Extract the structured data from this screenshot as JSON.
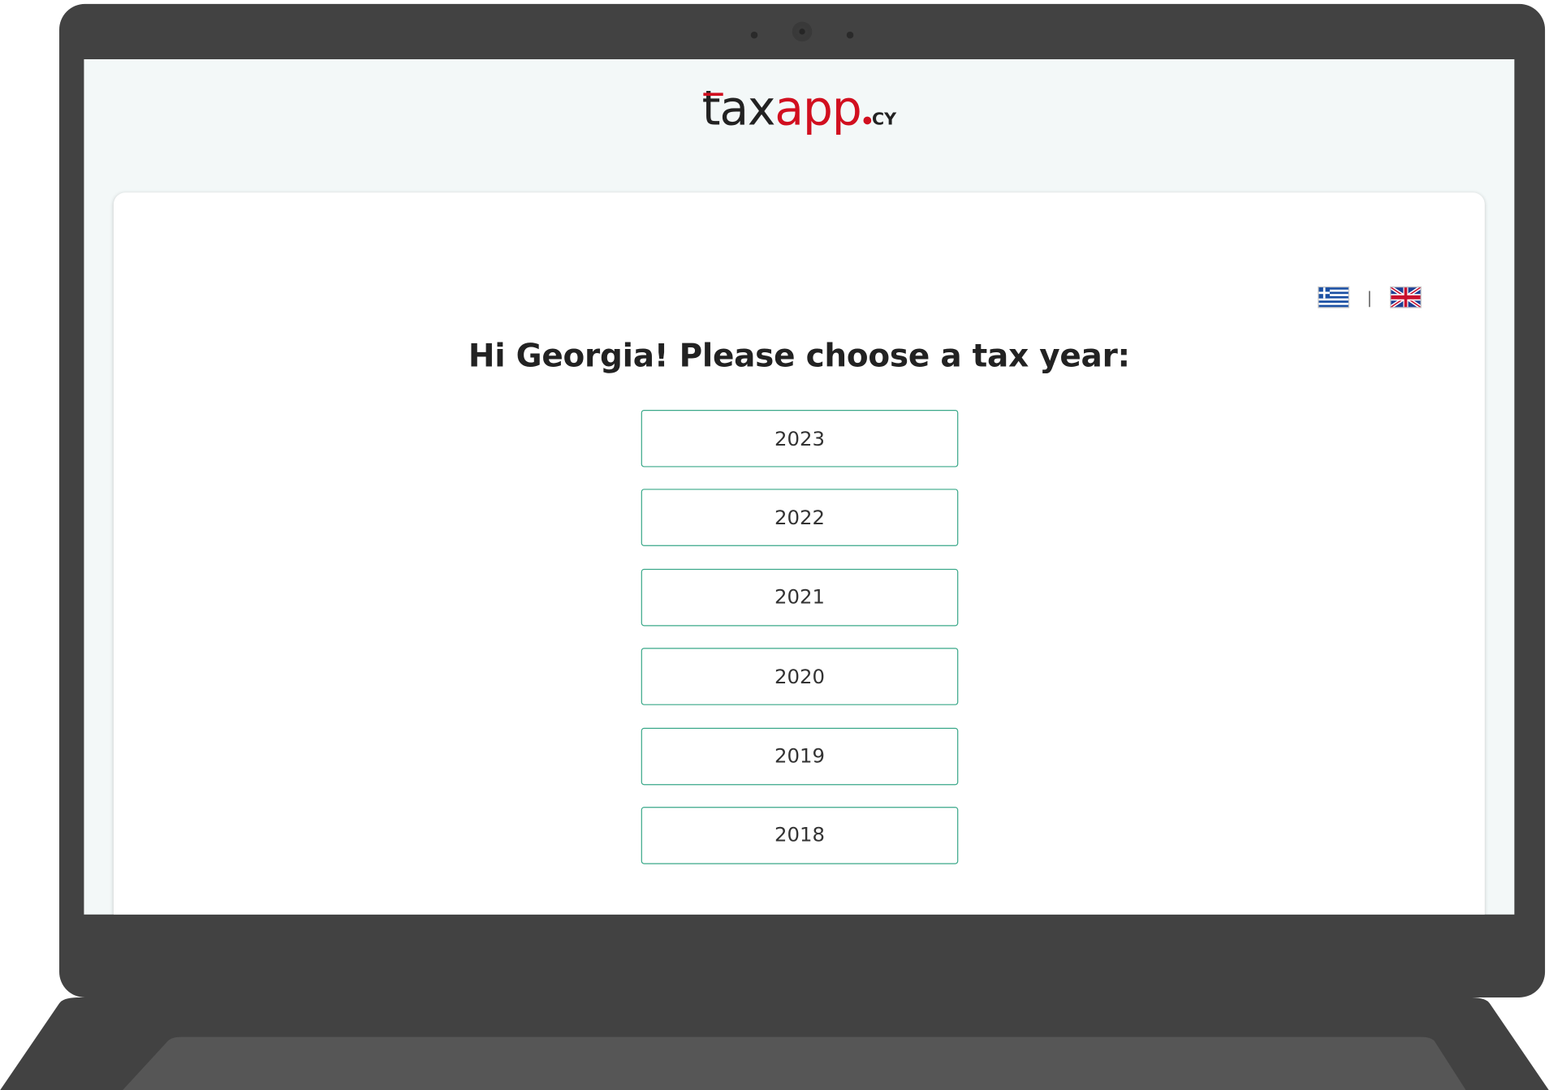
{
  "app": {
    "logo": {
      "t": "t",
      "ax": "ax",
      "app": "app",
      "cy": "CY"
    }
  },
  "language_switcher": {
    "separator": "|",
    "options": [
      "greek-flag-icon",
      "uk-flag-icon"
    ]
  },
  "main": {
    "prompt": "Hi Georgia! Please choose a tax year:",
    "years": [
      "2023",
      "2022",
      "2021",
      "2020",
      "2019",
      "2018"
    ]
  },
  "colors": {
    "brand_red": "#d10f1f",
    "button_border": "#3aa889",
    "screen_bg": "#f3f8f8",
    "laptop_body": "#424242"
  }
}
